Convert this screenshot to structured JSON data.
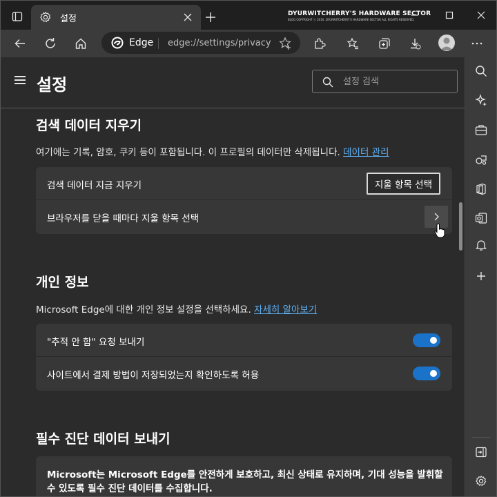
{
  "tab": {
    "title": "설정"
  },
  "watermark": {
    "title": "DYURWITCHERRY'S HARDWARE SECTOR",
    "subtitle": "BLOG COPYRIGHT ⓒ 2010. DYURWITCHERRY'S HARDWARE SECTOR ALL RIGHTS RESERVED."
  },
  "address_bar": {
    "brand": "Edge",
    "url": "edge://settings/privacy"
  },
  "settings": {
    "title": "설정",
    "search_placeholder": "설정 검색"
  },
  "clear_data": {
    "title": "검색 데이터 지우기",
    "description": "여기에는 기록, 암호, 쿠키 등이 포함됩니다. 이 프로필의 데이터만 삭제됩니다.",
    "link": "데이터 관리",
    "rows": [
      {
        "label": "검색 데이터 지금 지우기",
        "button": "지울 항목 선택"
      },
      {
        "label": "브라우저를 닫을 때마다 지울 항목 선택"
      }
    ]
  },
  "privacy": {
    "title": "개인 정보",
    "description": "Microsoft Edge에 대한 개인 정보 설정을 선택하세요.",
    "link": "자세히 알아보기",
    "rows": [
      {
        "label": "\"추적 안 함\" 요청 보내기",
        "toggle_on": true
      },
      {
        "label": "사이트에서 결제 방법이 저장되었는지 확인하도록 허용",
        "toggle_on": true
      }
    ]
  },
  "diagnostics": {
    "title": "필수 진단 데이터 보내기",
    "text": "Microsoft는 Microsoft Edge를 안전하게 보호하고, 최신 상태로 유지하며, 기대 성능을 발휘할 수 있도록 필수 진단 데이터를 수집합니다."
  },
  "colors": {
    "accent": "#1a73c8",
    "link": "#5eb1f7",
    "background": "#2b2b2b",
    "card": "#373737"
  }
}
